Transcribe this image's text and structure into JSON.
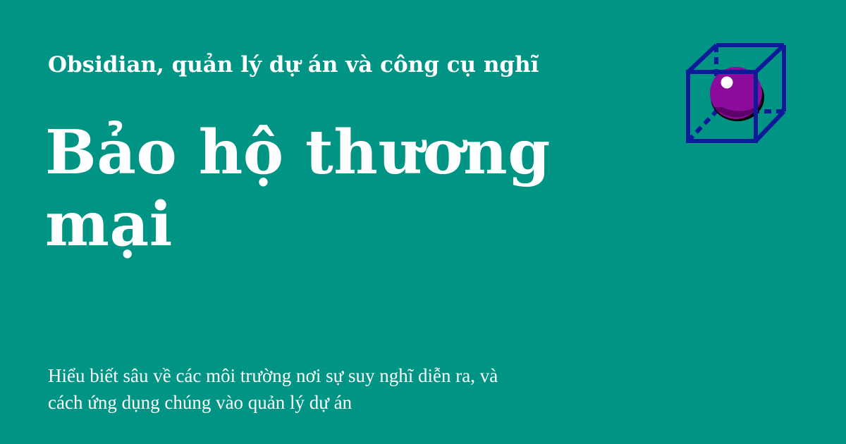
{
  "header": {
    "subtitle": "Obsidian, quản lý dự án và công cụ nghĩ"
  },
  "main": {
    "title": "Bảo hộ thương mại",
    "description_line_1": "Hiểu biết sâu về các môi trường nơi sự suy nghĩ diễn ra, và",
    "description_line_2": "cách ứng dụng chúng vào quản lý dự án"
  },
  "logo": {
    "icon": "cube-sphere-icon"
  },
  "colors": {
    "background": "#009485",
    "text": "#ffffff",
    "cube_stroke": "#0d1a9a",
    "sphere": "#8c0a9c",
    "sphere_shadow": "#000000",
    "sphere_highlight": "#ffffff"
  }
}
